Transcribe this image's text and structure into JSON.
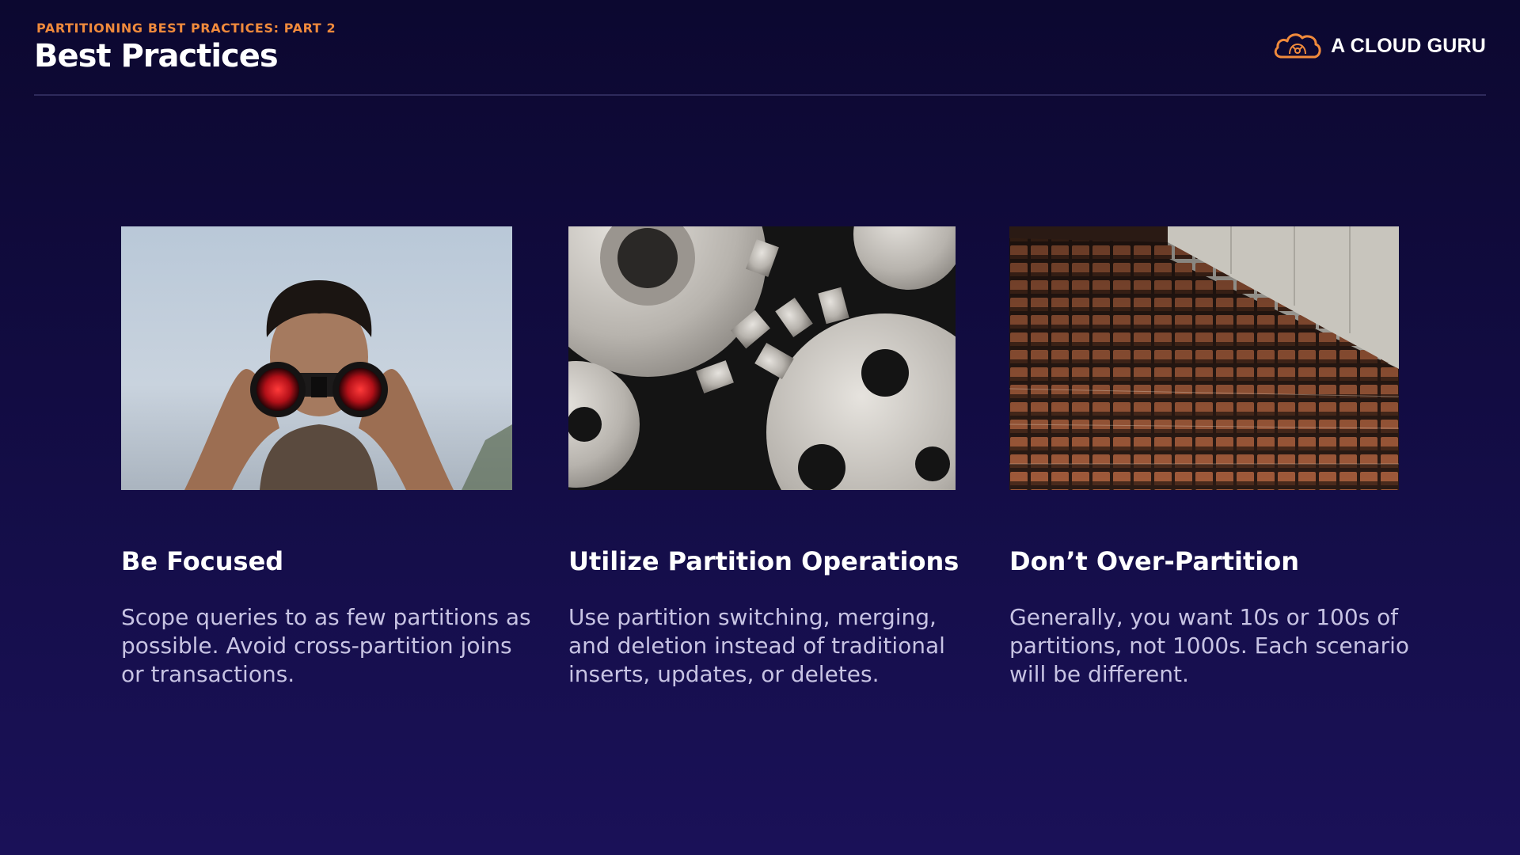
{
  "header": {
    "eyebrow": "PARTITIONING BEST PRACTICES: PART 2",
    "title": "Best Practices",
    "brand": {
      "name": "A CLOUD GURU",
      "logo_icon": "cloud-logo-icon",
      "logo_color": "#f08a3c"
    }
  },
  "colors": {
    "background": "#120c42",
    "accent": "#f08a3c",
    "divider": "#2e2a5c",
    "body_text": "#c7c3e3"
  },
  "cards": [
    {
      "image": "person-with-binoculars-photo",
      "title": "Be Focused",
      "body": "Scope queries to as few partitions as possible. Avoid cross-partition joins or transactions."
    },
    {
      "image": "interlocking-gears-photo",
      "title": "Utilize Partition Operations",
      "body": "Use partition switching, merging, and deletion instead of traditional inserts, updates, or deletes."
    },
    {
      "image": "empty-auditorium-seats-photo",
      "title": "Don’t Over-Partition",
      "body": "Generally, you want 10s or 100s of partitions, not 1000s. Each scenario will be different."
    }
  ]
}
